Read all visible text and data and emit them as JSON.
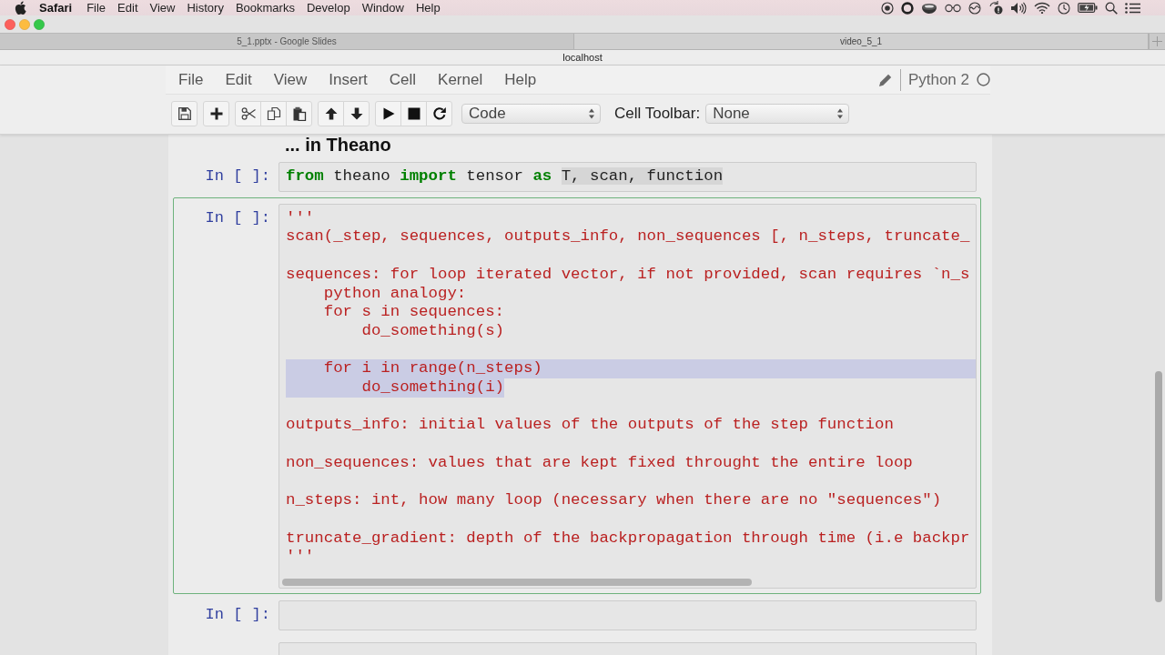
{
  "system_menu_bar": {
    "app_name": "Safari",
    "menus": [
      "File",
      "Edit",
      "View",
      "History",
      "Bookmarks",
      "Develop",
      "Window",
      "Help"
    ]
  },
  "browser": {
    "tabs": [
      {
        "title": "5_1.pptx - Google Slides",
        "selected": false
      },
      {
        "title": "video_5_1",
        "selected": true
      }
    ],
    "address": "localhost"
  },
  "notebook": {
    "menus": [
      "File",
      "Edit",
      "View",
      "Insert",
      "Cell",
      "Kernel",
      "Help"
    ],
    "kernel": "Python 2",
    "cell_type": "Code",
    "cell_toolbar_label": "Cell Toolbar:",
    "cell_toolbar": "None"
  },
  "cells": [
    {
      "kind": "heading",
      "text": "... in Theano"
    },
    {
      "kind": "code",
      "prompt": "In [ ]:",
      "selected": false,
      "scrollbar": false,
      "blocks": [
        {
          "lines": [
            {
              "selected": false,
              "tokens": [
                {
                  "text": "from",
                  "kind": "keyword",
                  "selected": false
                },
                {
                  "text": " theano ",
                  "kind": "name",
                  "selected": false
                },
                {
                  "text": "import",
                  "kind": "keyword",
                  "selected": false
                },
                {
                  "text": " tensor ",
                  "kind": "name",
                  "selected": false
                },
                {
                  "text": "as ",
                  "kind": "keyword",
                  "selected": false
                },
                {
                  "text": "T, scan, function",
                  "kind": "name",
                  "selected": true
                }
              ]
            }
          ]
        }
      ]
    },
    {
      "kind": "code",
      "prompt": "In [ ]:",
      "selected": true,
      "scrollbar": true,
      "blocks": [
        {
          "lines": [
            {
              "text": "'''",
              "kind": "string",
              "selected": false
            },
            {
              "text": "scan(_step, sequences, outputs_info, non_sequences [, n_steps, truncate_",
              "kind": "string",
              "selected": false
            }
          ]
        },
        {
          "lines": [
            {
              "text": "sequences: for loop iterated vector, if not provided, scan requires `n_s",
              "kind": "string",
              "selected": false
            },
            {
              "text": "    python analogy:",
              "kind": "string",
              "selected": false
            },
            {
              "text": "    for s in sequences:",
              "kind": "string",
              "selected": false
            },
            {
              "text": "        do_something(s)",
              "kind": "string",
              "selected": false
            }
          ]
        },
        {
          "lines": [
            {
              "text": "    for i in range(n_steps)",
              "kind": "string",
              "selected": true
            },
            {
              "text": "        do_something(i)",
              "kind": "string",
              "selected": true
            }
          ]
        },
        {
          "lines": [
            {
              "text": "outputs_info: initial values of the outputs of the step function",
              "kind": "string",
              "selected": false
            }
          ]
        },
        {
          "lines": [
            {
              "text": "non_sequences: values that are kept fixed throught the entire loop",
              "kind": "string",
              "selected": false
            }
          ]
        },
        {
          "lines": [
            {
              "text": "n_steps: int, how many loop (necessary when there are no \"sequences\")",
              "kind": "string",
              "selected": false
            }
          ]
        },
        {
          "lines": [
            {
              "text": "truncate_gradient: depth of the backpropagation through time (i.e backpr",
              "kind": "string",
              "selected": false
            },
            {
              "text": "'''",
              "kind": "string",
              "selected": false
            }
          ]
        }
      ]
    },
    {
      "kind": "code",
      "prompt": "In [ ]:",
      "selected": false,
      "scrollbar": false
    },
    {
      "kind": "code",
      "selected": false
    }
  ]
}
